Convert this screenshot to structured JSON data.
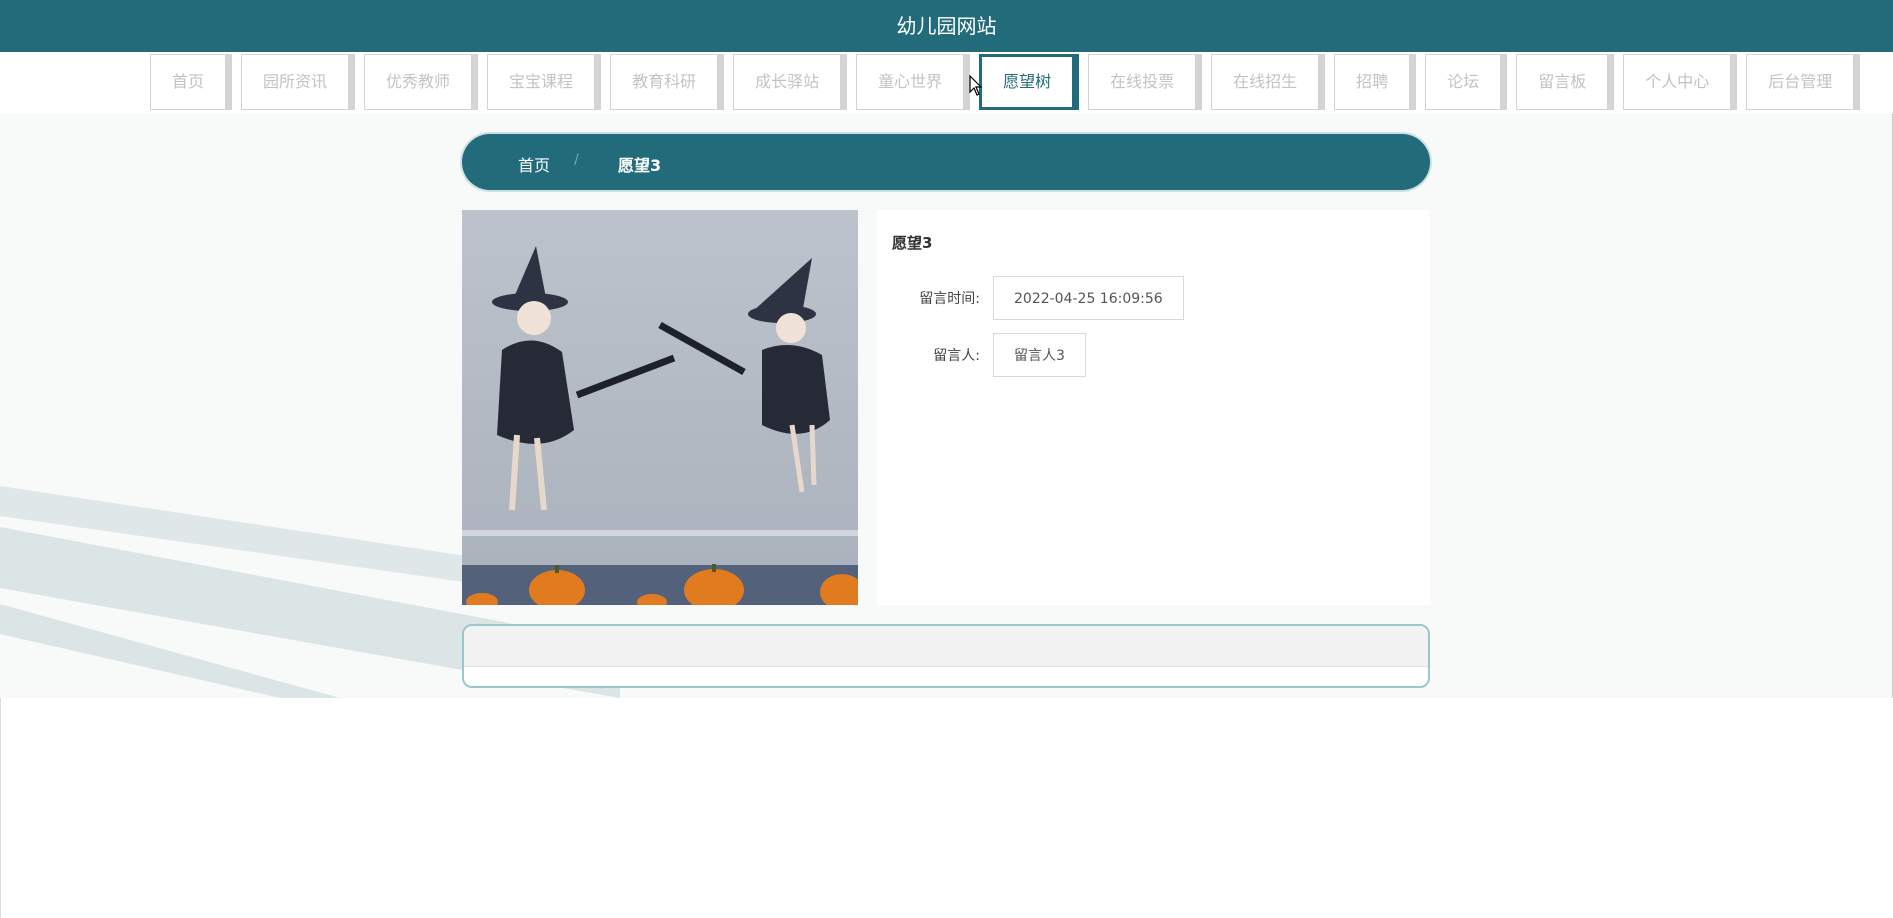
{
  "header": {
    "title": "幼儿园网站"
  },
  "nav": {
    "items": [
      {
        "label": "首页"
      },
      {
        "label": "园所资讯"
      },
      {
        "label": "优秀教师"
      },
      {
        "label": "宝宝课程"
      },
      {
        "label": "教育科研"
      },
      {
        "label": "成长驿站"
      },
      {
        "label": "童心世界"
      },
      {
        "label": "愿望树"
      },
      {
        "label": "在线投票"
      },
      {
        "label": "在线招生"
      },
      {
        "label": "招聘"
      },
      {
        "label": "论坛"
      },
      {
        "label": "留言板"
      },
      {
        "label": "个人中心"
      },
      {
        "label": "后台管理"
      }
    ],
    "active": "愿望树"
  },
  "breadcrumb": {
    "home": "首页",
    "separator": "/",
    "current": "愿望3"
  },
  "detail": {
    "title": "愿望3",
    "fields": [
      {
        "label": "留言时间:",
        "value": "2022-04-25 16:09:56"
      },
      {
        "label": "留言人:",
        "value": "留言人3"
      }
    ]
  },
  "image": {
    "icon": "photo-image",
    "description_icon": "witch-children-photo"
  },
  "colors": {
    "primary": "#216b7b",
    "nav_border": "#d4d4d4",
    "background": "#f8f9f9"
  }
}
